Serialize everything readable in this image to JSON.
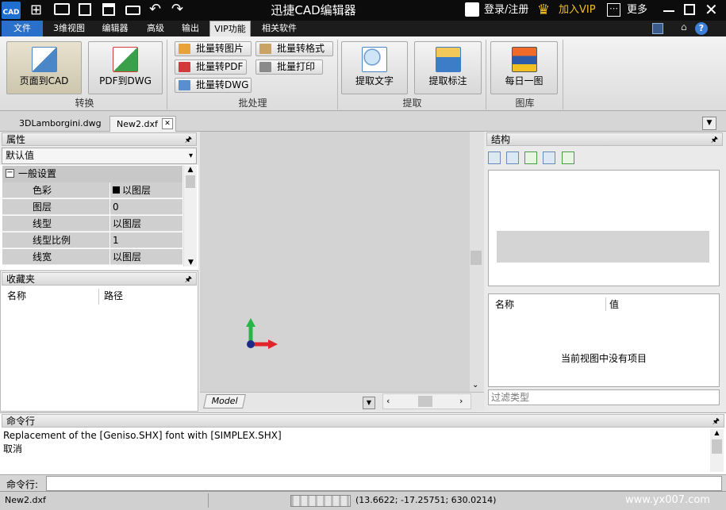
{
  "app": {
    "title": "迅捷CAD编辑器",
    "logo_text": "CAD"
  },
  "titlebar": {
    "login_label": "登录/注册",
    "vip_label": "加入VIP",
    "more_label": "更多"
  },
  "menu": [
    {
      "label": "文件"
    },
    {
      "label": "3维视图"
    },
    {
      "label": "编辑器"
    },
    {
      "label": "高级"
    },
    {
      "label": "输出"
    },
    {
      "label": "VIP功能"
    },
    {
      "label": "相关软件"
    }
  ],
  "ribbon": {
    "page_to_cad": "页面到CAD",
    "pdf_to_dwg": "PDF到DWG",
    "group_convert": "转换",
    "batch_image": "批量转图片",
    "batch_format": "批量转格式",
    "batch_pdf": "批量转PDF",
    "batch_print": "批量打印",
    "batch_dwg": "批量转DWG",
    "group_batch": "批处理",
    "extract_text": "提取文字",
    "extract_dim": "提取标注",
    "group_extract": "提取",
    "daily_image": "每日一图",
    "group_gallery": "图库"
  },
  "doc_tabs": [
    {
      "label": "3DLamborgini.dwg"
    },
    {
      "label": "New2.dxf"
    }
  ],
  "properties": {
    "header": "属性",
    "dropdown_value": "默认值",
    "section": "一般设置",
    "rows": [
      {
        "key": "色彩",
        "value": "以图层"
      },
      {
        "key": "图层",
        "value": "0"
      },
      {
        "key": "线型",
        "value": "以图层"
      },
      {
        "key": "线型比例",
        "value": "1"
      },
      {
        "key": "线宽",
        "value": "以图层"
      }
    ]
  },
  "favorites": {
    "header": "收藏夹",
    "col_name": "名称",
    "col_path": "路径"
  },
  "canvas": {
    "model_tab": "Model"
  },
  "structure": {
    "header": "结构",
    "col_name": "名称",
    "col_value": "值",
    "empty_text": "当前视图中没有项目",
    "filter_placeholder": "过滤类型"
  },
  "command": {
    "header": "命令行",
    "log": [
      "Replacement of the [Geniso.SHX] font with [SIMPLEX.SHX]",
      "取消"
    ],
    "prompt_label": "命令行:"
  },
  "status": {
    "file": "New2.dxf",
    "coords": "(13.6622; -17.25751; 630.0214)",
    "watermark": "www.yx007.com"
  },
  "colors": {
    "menu_bg": "#1c1c1c",
    "file_menu": "#2a6fc9",
    "vip_crown": "#f0c020",
    "axis_x": "#e0252a",
    "axis_y": "#27b548"
  }
}
